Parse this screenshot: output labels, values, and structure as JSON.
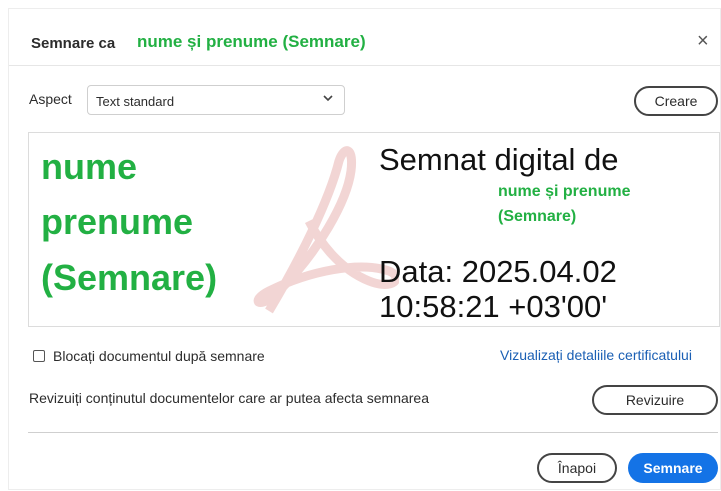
{
  "header": {
    "title": "Semnare ca",
    "signer_name": "nume și prenume (Semnare)",
    "close_glyph": "×"
  },
  "aspect": {
    "label": "Aspect",
    "selected": "Text standard",
    "create_label": "Creare"
  },
  "preview": {
    "name_lines": [
      "nume",
      "prenume",
      "(Semnare)"
    ],
    "signed_by": "Semnat digital de",
    "signer_lines": [
      "nume și prenume",
      "(Semnare)"
    ],
    "date_line": "Data: 2025.04.02",
    "time_line": "10:58:21 +03'00'",
    "watermark_icon": "acrobat-logo-watermark"
  },
  "options": {
    "lock_label": "Blocați documentul după semnare",
    "lock_checked": false,
    "cert_link": "Vizualizați detaliile certificatului"
  },
  "review": {
    "text": "Revizuiți conținutul documentelor care ar putea afecta semnarea",
    "button_label": "Revizuire"
  },
  "footer": {
    "back_label": "Înapoi",
    "sign_label": "Semnare"
  },
  "colors": {
    "accent": "#1473e6",
    "highlight_green": "#22b043",
    "link": "#1a5fb4"
  }
}
